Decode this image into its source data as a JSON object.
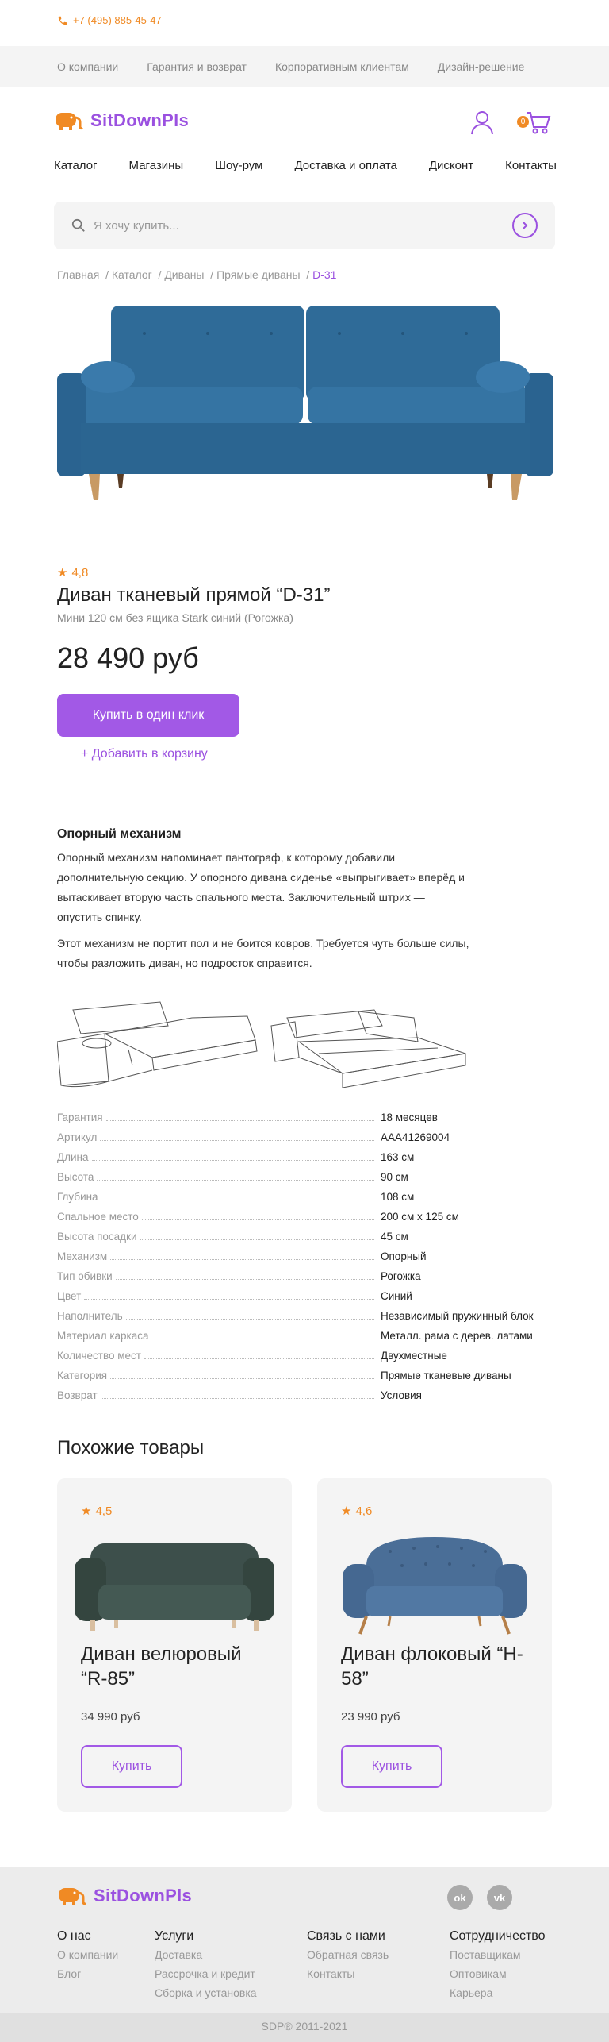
{
  "topbar": {
    "phone": "+7 (495) 885-45-47"
  },
  "topnav": [
    "О компании",
    "Гарантия и возврат",
    "Корпоративным клиентам",
    "Дизайн-решение"
  ],
  "header": {
    "logo": "SitDownPls",
    "cart_count": "0"
  },
  "mainnav": [
    "Каталог",
    "Магазины",
    "Шоу-рум",
    "Доставка и оплата",
    "Дисконт",
    "Контакты"
  ],
  "search": {
    "placeholder": "Я хочу купить..."
  },
  "breadcrumbs": {
    "items": [
      "Главная",
      "Каталог",
      "Диваны",
      "Прямые диваны"
    ],
    "current": "D-31",
    "sep": "/"
  },
  "product": {
    "rating": "4,8",
    "title": "Диван тканевый прямой “D-31”",
    "subtitle": "Мини 120 см без ящика Stark синий (Рогожка)",
    "price": "28 490 руб",
    "buy_label": "Купить в один клик",
    "add_to_cart_label": "+ Добавить в корзину"
  },
  "mechanism": {
    "title": "Опорный механизм",
    "p1": "Опорный механизм напоминает пантограф, к которому добавили дополнительную секцию. У опорного дивана сиденье «выпрыгивает» вперёд и вытаскивает вторую часть спального места. Заключительный штрих — опустить спинку.",
    "p2": "Этот механизм не портит пол и не боится ковров. Требуется чуть больше силы, чтобы разложить диван, но подросток справится."
  },
  "specs": [
    {
      "k": "Гарантия",
      "v": "18 месяцев"
    },
    {
      "k": "Артикул",
      "v": "AAA41269004"
    },
    {
      "k": "Длина",
      "v": "163 см"
    },
    {
      "k": "Высота",
      "v": "90 см"
    },
    {
      "k": "Глубина",
      "v": "108 см"
    },
    {
      "k": "Спальное место",
      "v": "200 см х 125 см"
    },
    {
      "k": "Высота посадки",
      "v": "45 см"
    },
    {
      "k": "Механизм",
      "v": "Опорный"
    },
    {
      "k": "Тип обивки",
      "v": "Рогожка"
    },
    {
      "k": "Цвет",
      "v": "Синий"
    },
    {
      "k": "Наполнитель",
      "v": "Независимый пружинный блок"
    },
    {
      "k": "Материал каркаса",
      "v": "Металл. рама с дерев. латами"
    },
    {
      "k": "Количество мест",
      "v": "Двухместные"
    },
    {
      "k": "Категория",
      "v": "Прямые тканевые диваны"
    },
    {
      "k": "Возврат",
      "v": "Условия"
    }
  ],
  "similar": {
    "title": "Похожие товары",
    "items": [
      {
        "rating": "4,5",
        "title": "Диван велюровый “R-85”",
        "price": "34 990 руб",
        "button": "Купить"
      },
      {
        "rating": "4,6",
        "title": "Диван флоковый “H-58”",
        "price": "23 990 руб",
        "button": "Купить"
      }
    ]
  },
  "footer": {
    "logo": "SitDownPls",
    "columns": [
      {
        "title": "О нас",
        "links": [
          "О компании",
          "Блог"
        ]
      },
      {
        "title": "Услуги",
        "links": [
          "Доставка",
          "Рассрочка и кредит",
          "Сборка и установка"
        ]
      },
      {
        "title": "Связь с нами",
        "links": [
          "Обратная связь",
          "Контакты"
        ]
      },
      {
        "title": "Сотрудничество",
        "links": [
          "Поставщикам",
          "Оптовикам",
          "Карьера"
        ]
      }
    ],
    "copyright": "SDP®   2011-2021"
  },
  "colors": {
    "accent": "#9b51e0",
    "orange": "#f08a24",
    "sofa_blue": "#2e6a96"
  }
}
